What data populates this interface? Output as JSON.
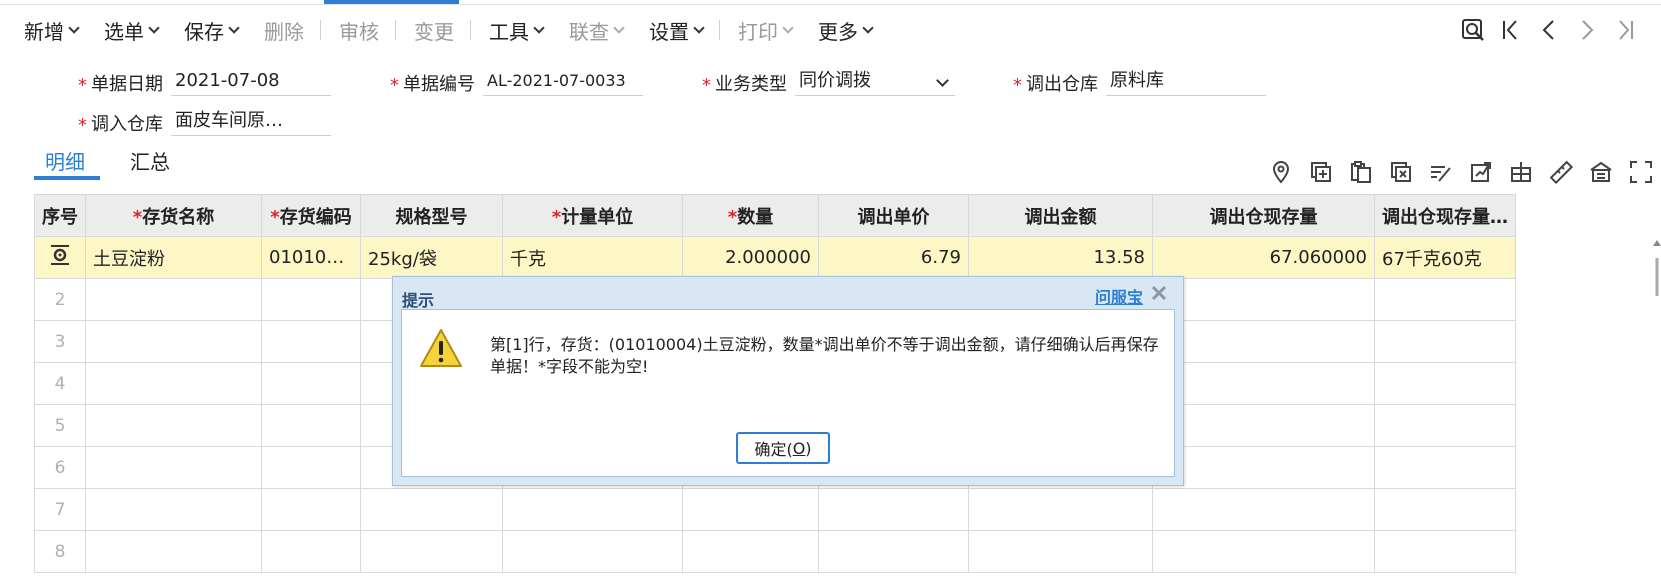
{
  "toolbar": {
    "items": [
      {
        "label": "新增",
        "disabled": false,
        "dropdown": true
      },
      {
        "label": "选单",
        "disabled": false,
        "dropdown": true
      },
      {
        "label": "保存",
        "disabled": false,
        "dropdown": true
      },
      {
        "label": "删除",
        "disabled": true,
        "dropdown": false
      },
      {
        "label": "审核",
        "disabled": true,
        "dropdown": false
      },
      {
        "label": "变更",
        "disabled": true,
        "dropdown": false
      },
      {
        "label": "工具",
        "disabled": false,
        "dropdown": true
      },
      {
        "label": "联查",
        "disabled": true,
        "dropdown": true
      },
      {
        "label": "设置",
        "disabled": false,
        "dropdown": true
      },
      {
        "label": "打印",
        "disabled": true,
        "dropdown": true
      },
      {
        "label": "更多",
        "disabled": false,
        "dropdown": true
      }
    ],
    "nav_icons": [
      "search-doc-icon",
      "first-page-icon",
      "prev-page-icon",
      "next-page-icon",
      "last-page-icon"
    ]
  },
  "form": {
    "doc_date": {
      "label": "单据日期",
      "value": "2021-07-08"
    },
    "doc_no": {
      "label": "单据编号",
      "value": "AL-2021-07-0033"
    },
    "biz_type": {
      "label": "业务类型",
      "value": "同价调拨"
    },
    "out_wh": {
      "label": "调出仓库",
      "value": "原料库"
    },
    "in_wh": {
      "label": "调入仓库",
      "value": "面皮车间原…"
    }
  },
  "tabs": {
    "detail": "明细",
    "summary": "汇总"
  },
  "grid_icons": [
    "location-pin-icon",
    "add-row-icon",
    "copy-row-icon",
    "delete-row-icon",
    "batch-edit-icon",
    "export-icon",
    "split-icon",
    "ruler-icon",
    "warehouse-icon",
    "fullscreen-icon"
  ],
  "table": {
    "columns": [
      "序号",
      "存货名称",
      "存货编码",
      "规格型号",
      "计量单位",
      "数量",
      "调出单价",
      "调出金额",
      "调出仓现存量",
      "调出仓现存量…"
    ],
    "row1": {
      "name": "土豆淀粉",
      "code": "01010…",
      "spec": "25kg/袋",
      "unit": "千克",
      "qty": "2.000000",
      "price": "6.79",
      "amount": "13.58",
      "stock": "67.060000",
      "stock2": "67千克60克"
    },
    "row_numbers": [
      "2",
      "3",
      "4",
      "5",
      "6",
      "7",
      "8"
    ]
  },
  "dialog": {
    "title": "提示",
    "help": "问服宝",
    "message": "第[1]行，存货：(01010004)土豆淀粉，数量*调出单价不等于调出金额，请仔细确认后再保存单据！*字段不能为空!",
    "ok_prefix": "确定(",
    "ok_key": "O",
    "ok_suffix": ")"
  }
}
